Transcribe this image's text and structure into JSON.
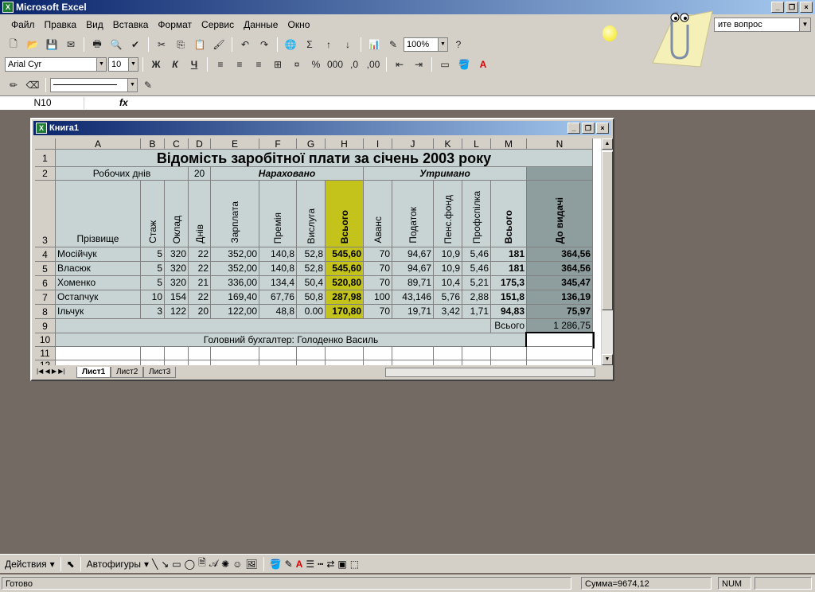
{
  "app": {
    "title": "Microsoft Excel",
    "help_placeholder": "ите вопрос"
  },
  "menu": [
    "Файл",
    "Правка",
    "Вид",
    "Вставка",
    "Формат",
    "Сервис",
    "Данные",
    "Окно"
  ],
  "toolbar": {
    "zoom": "100%",
    "font": "Arial Cyr",
    "size": "10",
    "bold": "Ж",
    "italic": "К",
    "underline": "Ч",
    "sum": "Σ"
  },
  "formula": {
    "name_box": "N10",
    "fx": "fx",
    "value": ""
  },
  "workbook": {
    "title": "Книга1"
  },
  "columns": [
    "A",
    "B",
    "C",
    "D",
    "E",
    "F",
    "G",
    "H",
    "I",
    "J",
    "K",
    "L",
    "M",
    "N"
  ],
  "rows": [
    "1",
    "2",
    "3",
    "4",
    "5",
    "6",
    "7",
    "8",
    "9",
    "10",
    "11",
    "12"
  ],
  "sheet": {
    "title": "Відомість заробітної плати за січень 2003 року",
    "row2": {
      "work_days_label": "Робочих днів",
      "work_days": "20",
      "accrued": "Нараховано",
      "withheld": "Утримано"
    },
    "headers": [
      "Прізвище",
      "Стаж",
      "Оклад",
      "Днів",
      "Зарплата",
      "Премія",
      "Вислуга",
      "Всього",
      "Аванс",
      "Податок",
      "Пенс.фонд",
      "Профспілка",
      "Всього",
      "До видачі"
    ],
    "data": [
      [
        "Мосійчук",
        "5",
        "320",
        "22",
        "352,00",
        "140,8",
        "52,8",
        "545,60",
        "70",
        "94,67",
        "10,9",
        "5,46",
        "181",
        "364,56"
      ],
      [
        "Власюк",
        "5",
        "320",
        "22",
        "352,00",
        "140,8",
        "52,8",
        "545,60",
        "70",
        "94,67",
        "10,9",
        "5,46",
        "181",
        "364,56"
      ],
      [
        "Хоменко",
        "5",
        "320",
        "21",
        "336,00",
        "134,4",
        "50,4",
        "520,80",
        "70",
        "89,71",
        "10,4",
        "5,21",
        "175,3",
        "345,47"
      ],
      [
        "Остапчук",
        "10",
        "154",
        "22",
        "169,40",
        "67,76",
        "50,8",
        "287,98",
        "100",
        "43,146",
        "5,76",
        "2,88",
        "151,8",
        "136,19"
      ],
      [
        "Ільчук",
        "3",
        "122",
        "20",
        "122,00",
        "48,8",
        "0.00",
        "170,80",
        "70",
        "19,71",
        "3,42",
        "1,71",
        "94,83",
        "75,97"
      ]
    ],
    "total_label": "Всього",
    "total_value": "1 286,75",
    "accountant": "Головний бухгалтер:   Голоденко Василь"
  },
  "sheet_tabs": [
    "Лист1",
    "Лист2",
    "Лист3"
  ],
  "drawing": {
    "actions": "Действия",
    "autoshapes": "Автофигуры"
  },
  "status": {
    "ready": "Готово",
    "sum": "Сумма=9674,12",
    "num": "NUM"
  }
}
